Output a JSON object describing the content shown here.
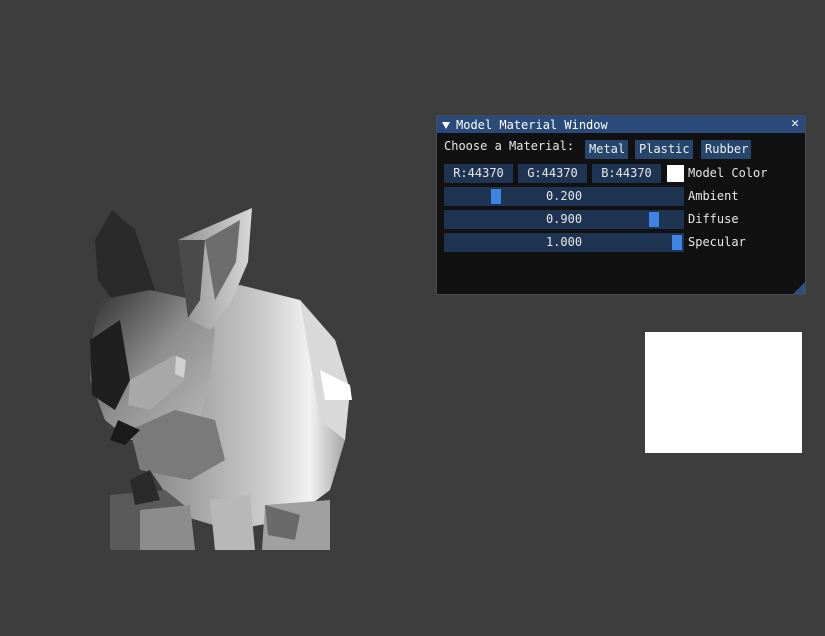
{
  "window": {
    "title": "Model Material Window",
    "close_glyph": "✕",
    "collapse_icon": "triangle-down-icon"
  },
  "material": {
    "label": "Choose a Material:",
    "buttons": [
      "Metal",
      "Plastic",
      "Rubber"
    ]
  },
  "color": {
    "r_label": "R:44370",
    "g_label": "G:44370",
    "b_label": "B:44370",
    "swatch": "#ffffff",
    "label": "Model Color"
  },
  "sliders": [
    {
      "label": "Ambient",
      "display": "0.200",
      "value": 0.2,
      "min": 0,
      "max": 1
    },
    {
      "label": "Diffuse",
      "display": "0.900",
      "value": 0.9,
      "min": 0,
      "max": 1
    },
    {
      "label": "Specular",
      "display": "1.000",
      "value": 1.0,
      "min": 0,
      "max": 1
    }
  ],
  "colors": {
    "background": "#3d3d3d",
    "title_bar": "#294a7a",
    "button": "#26466e",
    "frame": "#1f3352",
    "slider_grab": "#3d85e0",
    "preview_quad": "#ffffff"
  }
}
